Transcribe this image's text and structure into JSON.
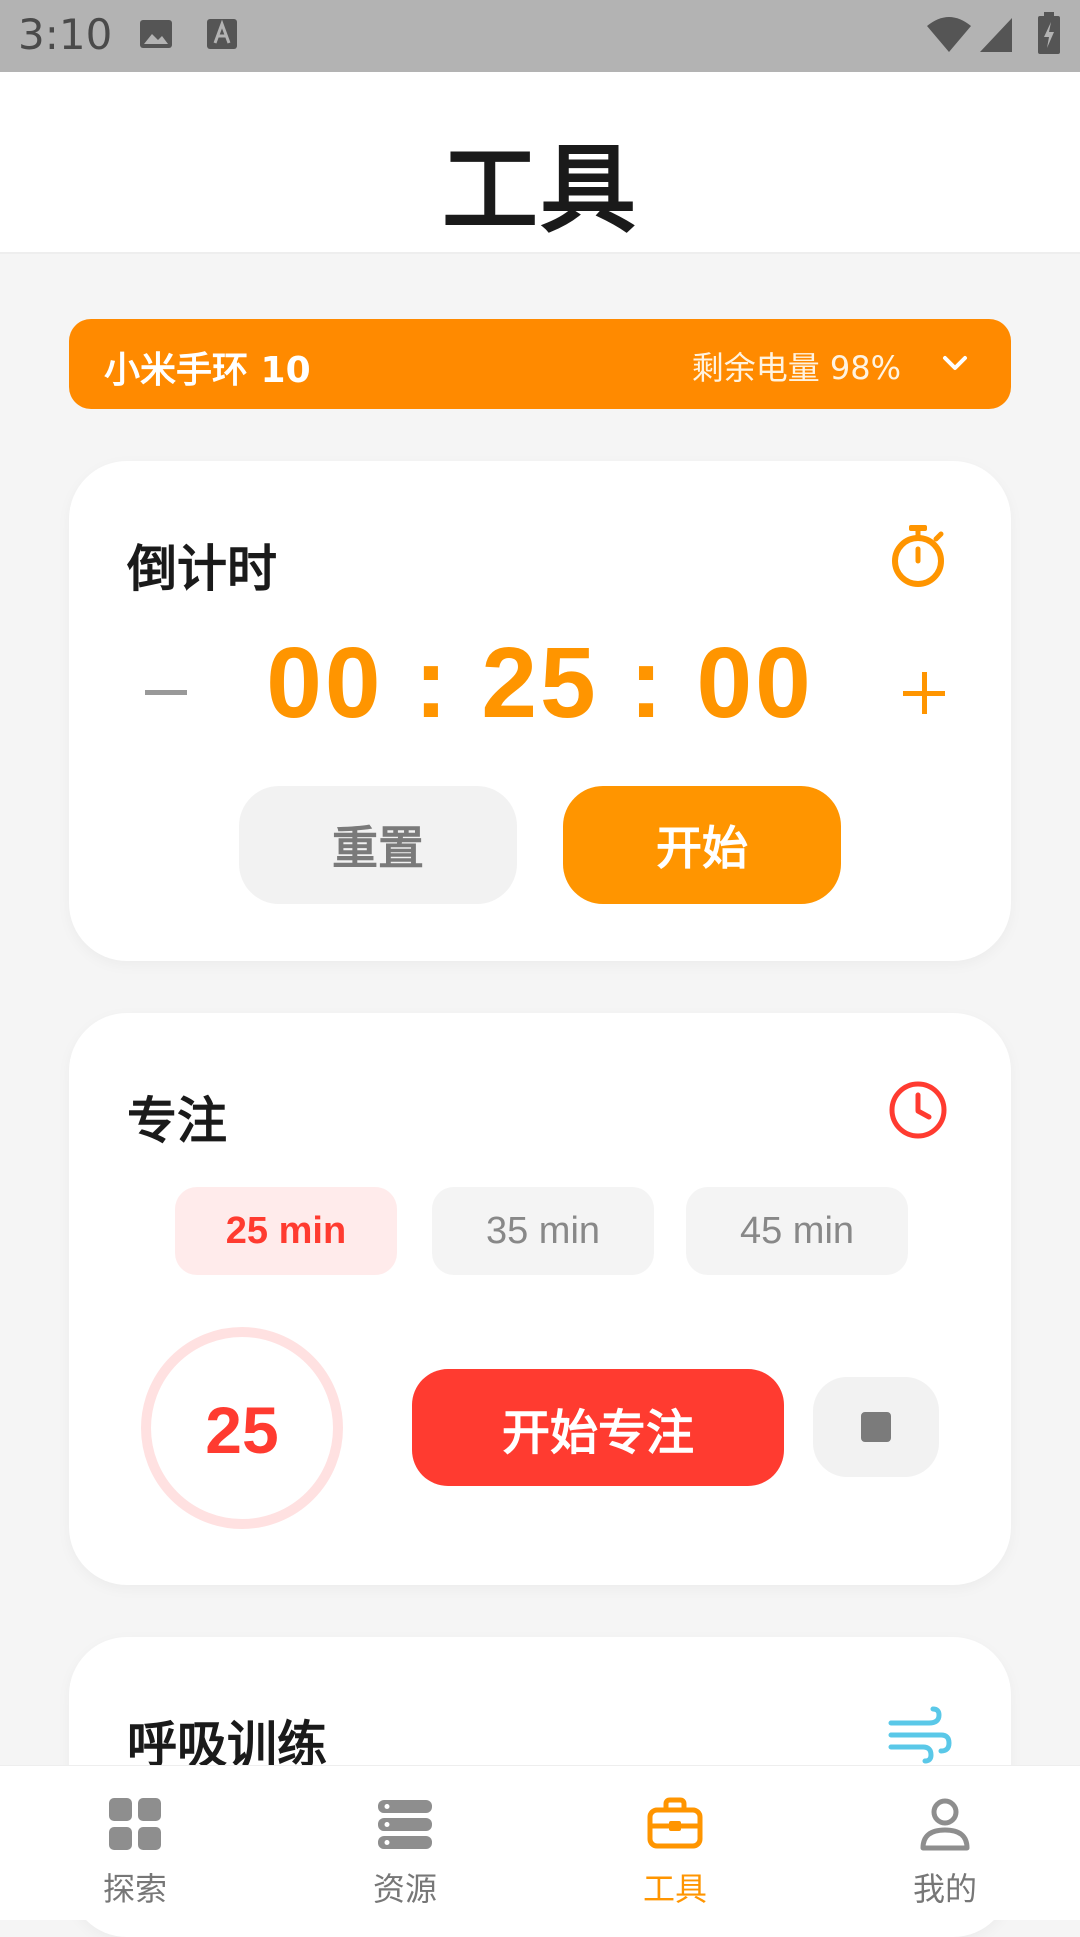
{
  "status_bar": {
    "time": "3:10"
  },
  "header": {
    "title": "工具"
  },
  "device": {
    "name": "小米手环 10",
    "battery_label": "剩余电量 98%"
  },
  "countdown": {
    "title": "倒计时",
    "time": "00 : 25 : 00",
    "minus": "−",
    "plus": "+",
    "reset_label": "重置",
    "start_label": "开始"
  },
  "focus": {
    "title": "专注",
    "durations": [
      {
        "label": "25 min",
        "selected": true
      },
      {
        "label": "35 min",
        "selected": false
      },
      {
        "label": "45 min",
        "selected": false
      }
    ],
    "ring_value": "25",
    "start_label": "开始专注"
  },
  "breathing": {
    "title": "呼吸训练"
  },
  "nav": {
    "items": [
      {
        "label": "探索",
        "icon": "grid-icon",
        "active": false
      },
      {
        "label": "资源",
        "icon": "server-icon",
        "active": false
      },
      {
        "label": "工具",
        "icon": "toolbox-icon",
        "active": true
      },
      {
        "label": "我的",
        "icon": "person-icon",
        "active": false
      }
    ]
  },
  "colors": {
    "accent": "#ff9500",
    "device_bar": "#ff8a00",
    "focus_red": "#ff3b30",
    "chip_selected_bg": "#ffebeb",
    "breath_teal": "#5ac8e8"
  }
}
